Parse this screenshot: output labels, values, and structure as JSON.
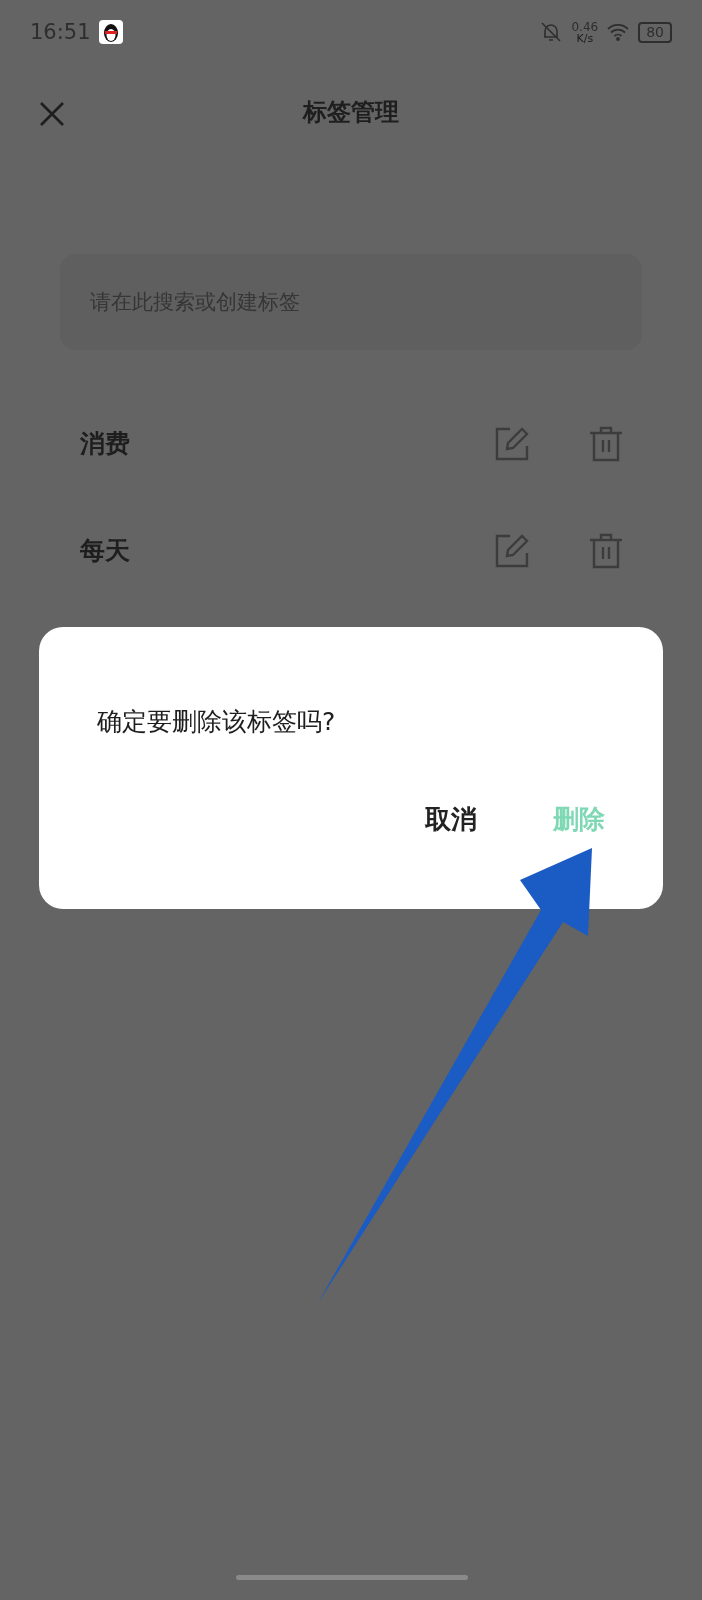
{
  "status_bar": {
    "time": "16:51",
    "net_speed": "0.46",
    "net_unit": "K/s",
    "battery": "80"
  },
  "header": {
    "title": "标签管理"
  },
  "search": {
    "placeholder": "请在此搜索或创建标签"
  },
  "tags": [
    {
      "name": "消费"
    },
    {
      "name": "每天"
    }
  ],
  "dialog": {
    "message": "确定要删除该标签吗?",
    "buttons": [
      {
        "label": "取消",
        "kind": "cancel"
      },
      {
        "label": "删除",
        "kind": "confirm"
      }
    ]
  }
}
